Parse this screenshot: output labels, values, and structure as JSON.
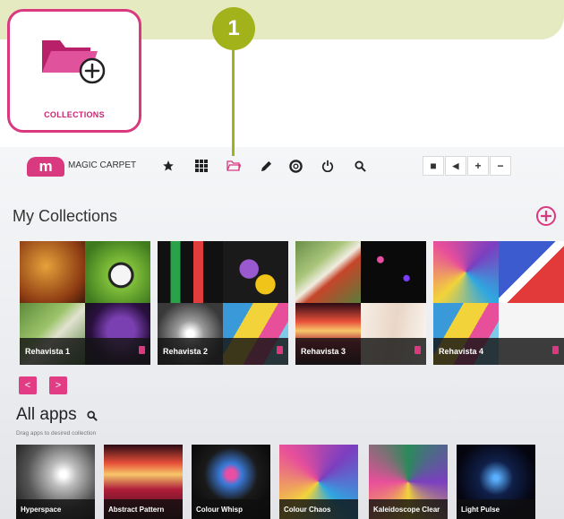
{
  "callout": {
    "step": "1",
    "card_label": "COLLECTIONS"
  },
  "brand": {
    "logo_letter": "m",
    "name": "MAGIC CARPET"
  },
  "nav_icons": [
    "favorites-star-icon",
    "apps-grid-icon",
    "collections-folder-icon",
    "pencil-icon",
    "help-lifebuoy-icon",
    "power-icon",
    "search-icon"
  ],
  "window_controls": {
    "stop": "■",
    "announce": "◀",
    "zoom_in": "+",
    "zoom_out": "−"
  },
  "collections": {
    "heading": "My Collections",
    "items": [
      {
        "name": "Rehavista 1"
      },
      {
        "name": "Rehavista 2"
      },
      {
        "name": "Rehavista 3"
      },
      {
        "name": "Rehavista 4"
      }
    ],
    "prev": "<",
    "next": ">"
  },
  "all_apps": {
    "heading": "All apps",
    "hint": "Drag apps to desired collection",
    "items": [
      {
        "name": "Hyperspace"
      },
      {
        "name": "Abstract Pattern"
      },
      {
        "name": "Colour Whisp"
      },
      {
        "name": "Colour Chaos"
      },
      {
        "name": "Kaleidoscope Clear"
      },
      {
        "name": "Light Pulse"
      }
    ]
  },
  "colors": {
    "accent": "#d8397f",
    "badge": "#a2b21a",
    "callout_bg": "#e6eac0"
  }
}
